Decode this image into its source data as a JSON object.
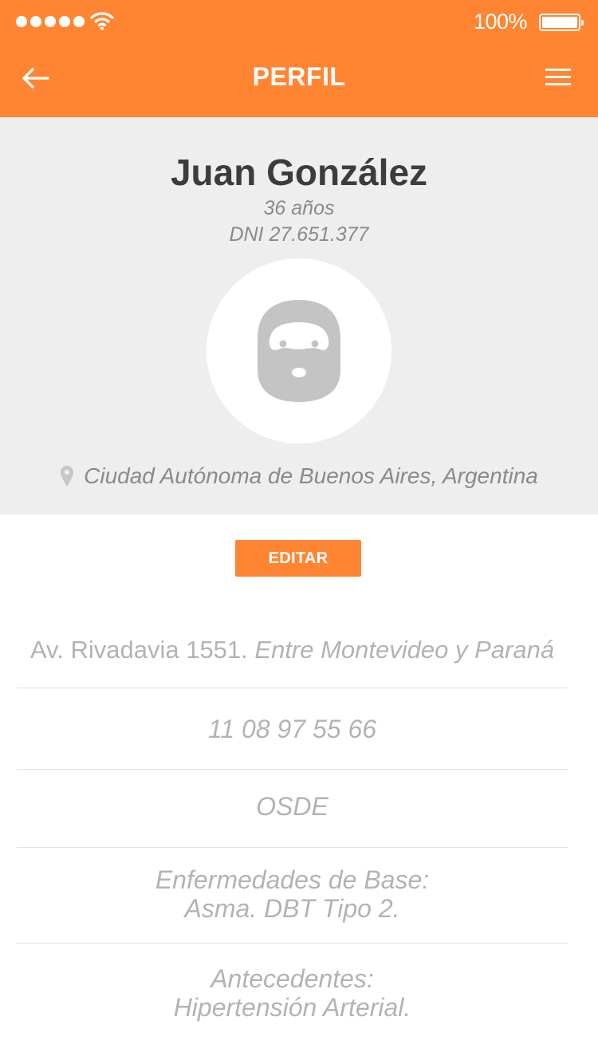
{
  "status_bar": {
    "battery_percent": "100%",
    "signal_bars": 5,
    "icons": [
      "signal-dots-icon",
      "wifi-icon",
      "battery-icon"
    ]
  },
  "nav": {
    "title": "PERFIL",
    "back_icon": "arrow-left-icon",
    "menu_icon": "hamburger-menu-icon"
  },
  "profile": {
    "name": "Juan González",
    "age": "36 años",
    "dni": "DNI 27.651.377",
    "avatar_icon": "bearded-man-avatar-icon",
    "location_icon": "map-pin-icon",
    "location": "Ciudad Autónoma de Buenos Aires, Argentina"
  },
  "actions": {
    "edit_label": "EDITAR"
  },
  "details": {
    "address_street": "Av. Rivadavia 1551.",
    "address_between": "Entre Montevideo y Paraná",
    "phone": "11 08 97 55 66",
    "insurance": "OSDE",
    "diseases_title": "Enfermedades de Base:",
    "diseases_value": "Asma. DBT Tipo 2.",
    "history_title": "Antecedentes:",
    "history_value": "Hipertensión Arterial."
  },
  "colors": {
    "accent": "#FF8533",
    "header_text": "#FFFFFF",
    "profile_bg": "#EEEEEE",
    "name_text": "#3C3C3C",
    "muted_text": "#8A8A8A",
    "detail_text": "#B3B3B3",
    "avatar_gray": "#C4C4C4"
  }
}
